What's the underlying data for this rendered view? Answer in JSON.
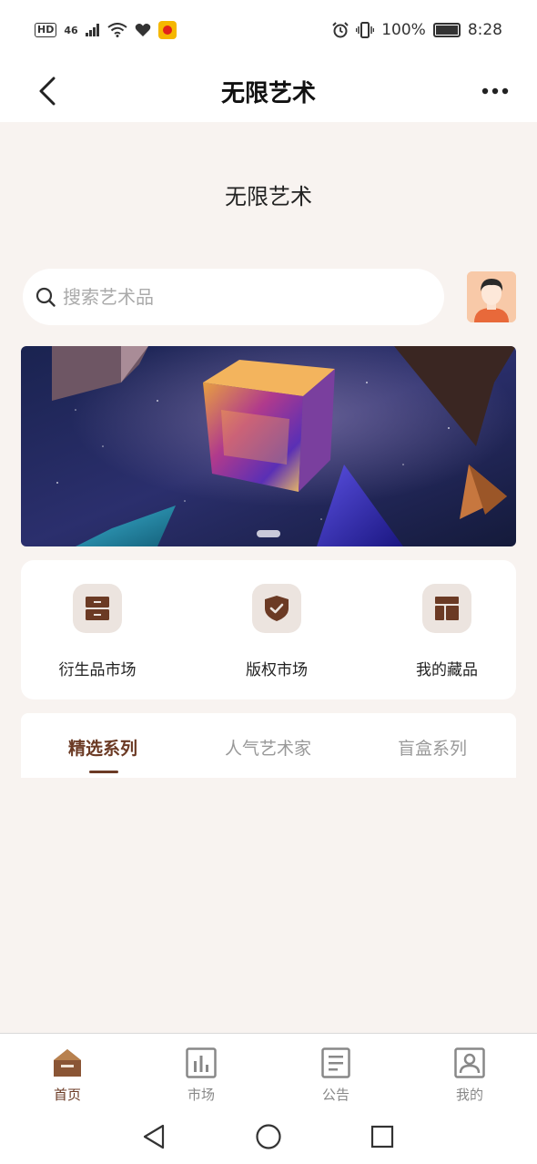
{
  "status_bar": {
    "left_badges": [
      "HD",
      "46"
    ],
    "battery": "100%",
    "time": "8:28"
  },
  "header": {
    "title": "无限艺术"
  },
  "page": {
    "subtitle": "无限艺术"
  },
  "search": {
    "placeholder": "搜索艺术品",
    "value": ""
  },
  "banner": {
    "page_count": 1,
    "active_index": 0
  },
  "quick_menu": [
    {
      "label": "衍生品市场",
      "icon": "derivatives-market-icon"
    },
    {
      "label": "版权市场",
      "icon": "copyright-shield-icon"
    },
    {
      "label": "我的藏品",
      "icon": "my-collection-icon"
    }
  ],
  "tabs": [
    {
      "label": "精选系列",
      "active": true
    },
    {
      "label": "人气艺术家",
      "active": false
    },
    {
      "label": "盲盒系列",
      "active": false
    }
  ],
  "bottom_nav": [
    {
      "label": "首页",
      "icon": "home-icon",
      "active": true
    },
    {
      "label": "市场",
      "icon": "chart-icon",
      "active": false
    },
    {
      "label": "公告",
      "icon": "notice-icon",
      "active": false
    },
    {
      "label": "我的",
      "icon": "profile-icon",
      "active": false
    }
  ],
  "colors": {
    "accent": "#6b3a24",
    "background": "#f8f3f0",
    "icon_bg": "#ece4df"
  }
}
